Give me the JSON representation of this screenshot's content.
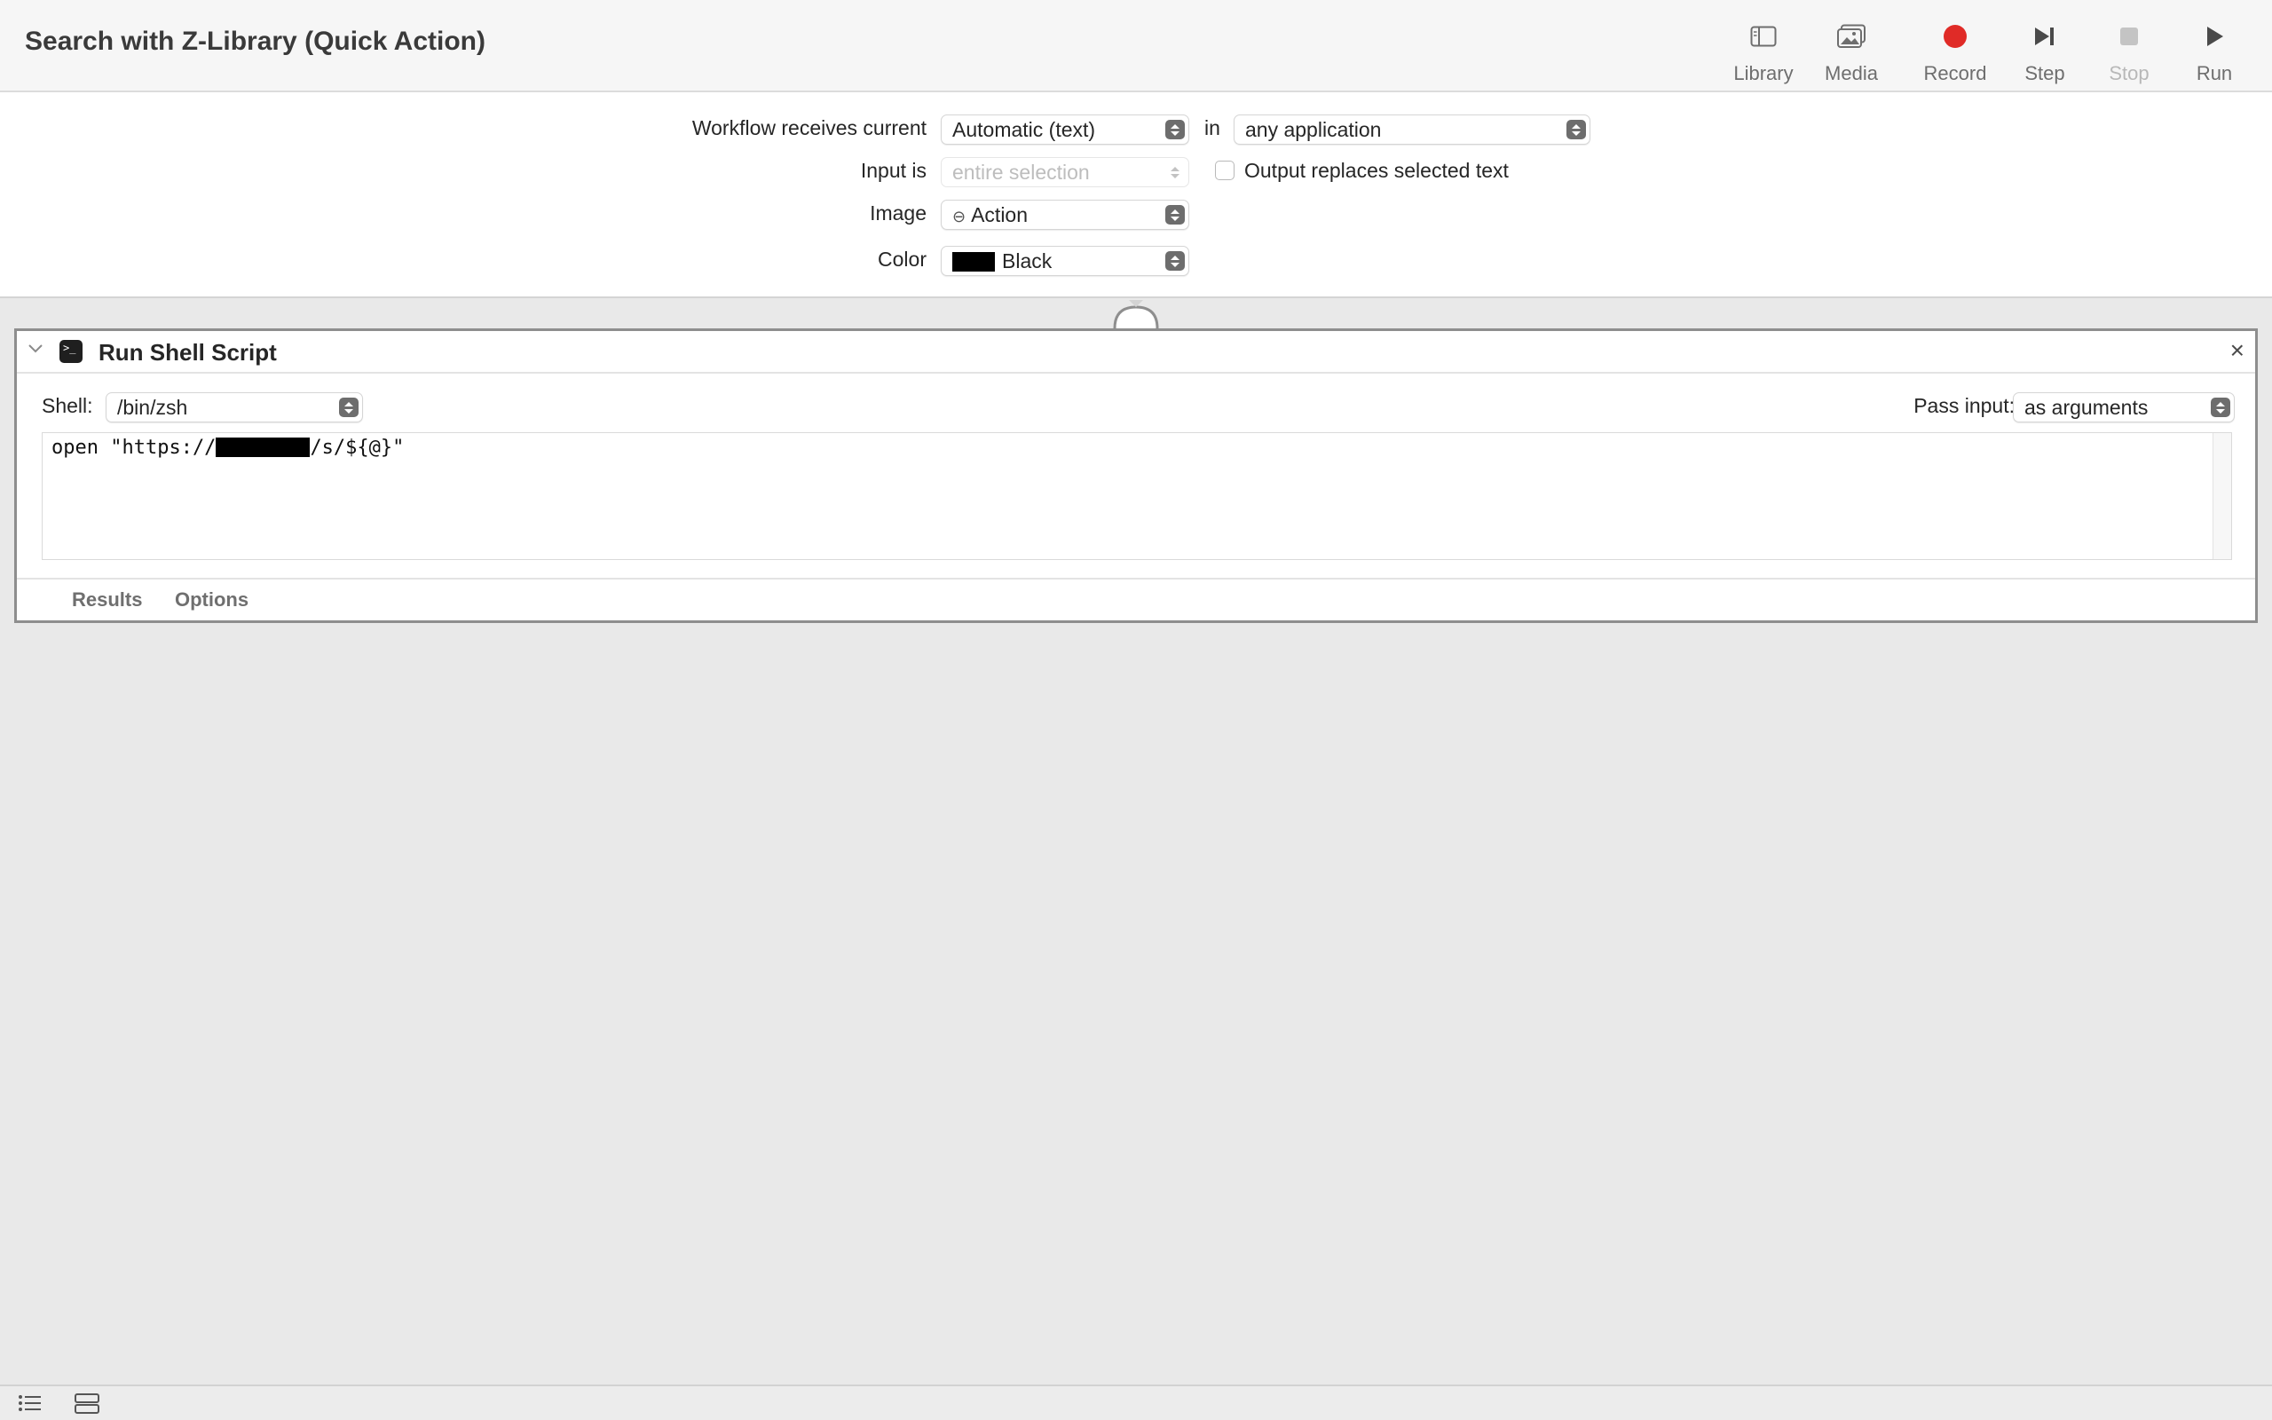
{
  "window": {
    "title": "Search with Z-Library (Quick Action)"
  },
  "toolbar": {
    "library": "Library",
    "media": "Media",
    "record": "Record",
    "step": "Step",
    "stop": "Stop",
    "run": "Run",
    "record_color": "#e02b27"
  },
  "workflow": {
    "receives_label": "Workflow receives current",
    "receives_value": "Automatic (text)",
    "in_label": "in",
    "application_value": "any application",
    "input_is_label": "Input is",
    "input_is_value": "entire selection",
    "output_replaces_label": "Output replaces selected text",
    "image_label": "Image",
    "image_value": "Action",
    "image_icon": "minus-circle-icon",
    "color_label": "Color",
    "color_value": "Black",
    "color_swatch": "#000000"
  },
  "action": {
    "title": "Run Shell Script",
    "icon": "terminal-icon",
    "shell_label": "Shell:",
    "shell_value": "/bin/zsh",
    "pass_input_label": "Pass input:",
    "pass_input_value": "as arguments",
    "code_prefix": "open \"https://",
    "code_suffix": "/s/${@}\"",
    "tabs": [
      "Results",
      "Options"
    ]
  }
}
